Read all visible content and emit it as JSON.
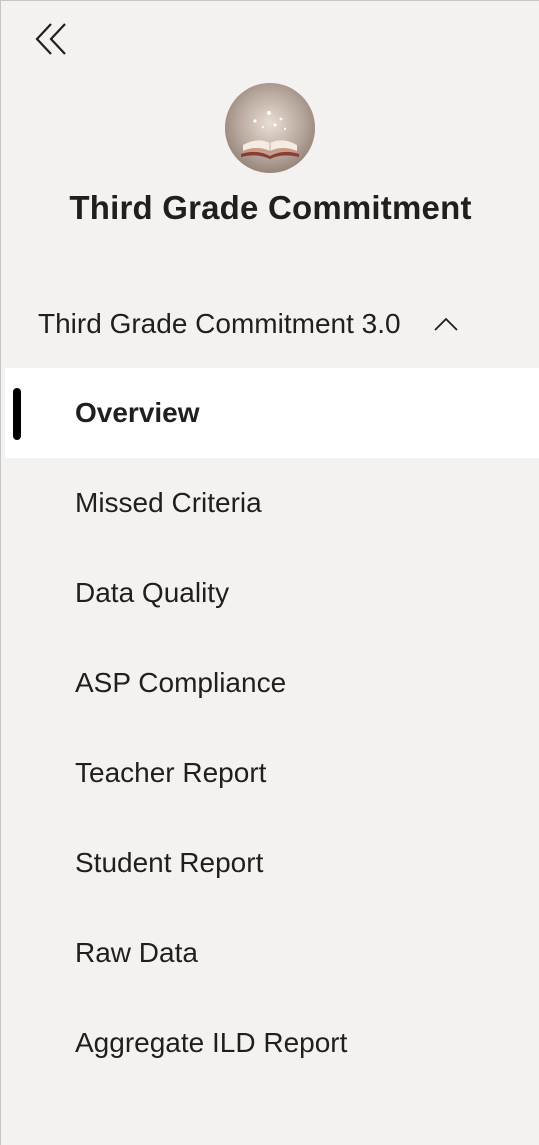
{
  "nav_pane": {
    "collapse_icon": "double-chevron-left-icon",
    "workspace": {
      "avatar_icon": "open-book-image",
      "title": "Third Grade Commitment"
    },
    "section": {
      "label": "Third Grade Commitment 3.0",
      "expanded": true,
      "chevron_icon": "chevron-up-icon"
    },
    "items": [
      {
        "label": "Overview",
        "active": true
      },
      {
        "label": "Missed Criteria",
        "active": false
      },
      {
        "label": "Data Quality",
        "active": false
      },
      {
        "label": "ASP Compliance",
        "active": false
      },
      {
        "label": "Teacher Report",
        "active": false
      },
      {
        "label": "Student Report",
        "active": false
      },
      {
        "label": "Raw Data",
        "active": false
      },
      {
        "label": "Aggregate ILD Report",
        "active": false
      }
    ]
  }
}
